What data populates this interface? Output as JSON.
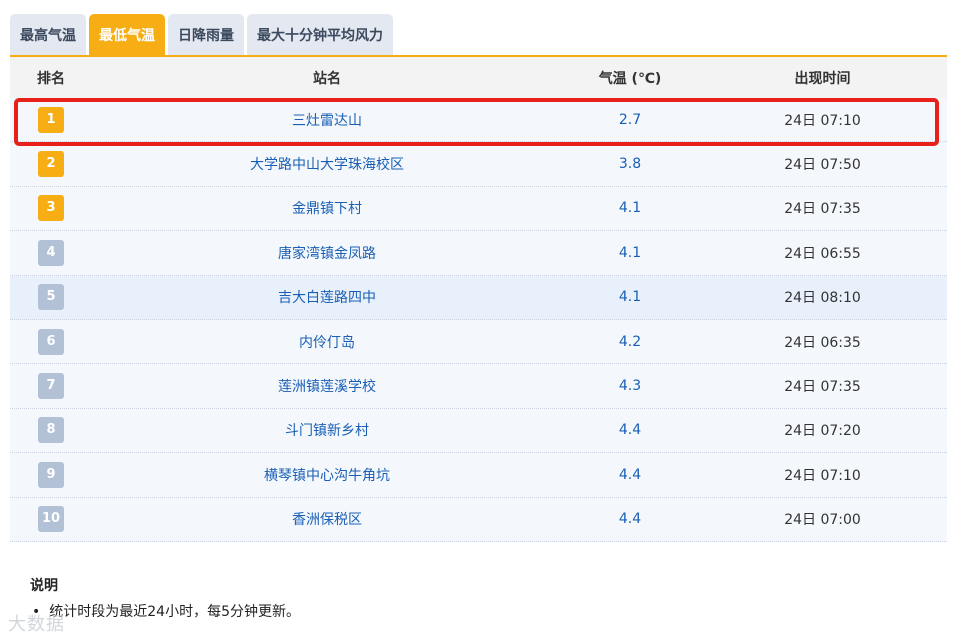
{
  "tabs": [
    {
      "label": "最高气温",
      "active": false
    },
    {
      "label": "最低气温",
      "active": true
    },
    {
      "label": "日降雨量",
      "active": false
    },
    {
      "label": "最大十分钟平均风力",
      "active": false
    }
  ],
  "table": {
    "headers": {
      "rank": "排名",
      "station": "站名",
      "temp": "气温 (℃)",
      "time": "出现时间"
    },
    "rows": [
      {
        "rank": "1",
        "station": "三灶雷达山",
        "temp": "2.7",
        "time": "24日 07:10"
      },
      {
        "rank": "2",
        "station": "大学路中山大学珠海校区",
        "temp": "3.8",
        "time": "24日 07:50"
      },
      {
        "rank": "3",
        "station": "金鼎镇下村",
        "temp": "4.1",
        "time": "24日 07:35"
      },
      {
        "rank": "4",
        "station": "唐家湾镇金凤路",
        "temp": "4.1",
        "time": "24日 06:55"
      },
      {
        "rank": "5",
        "station": "吉大白莲路四中",
        "temp": "4.1",
        "time": "24日 08:10"
      },
      {
        "rank": "6",
        "station": "内伶仃岛",
        "temp": "4.2",
        "time": "24日 06:35"
      },
      {
        "rank": "7",
        "station": "莲洲镇莲溪学校",
        "temp": "4.3",
        "time": "24日 07:35"
      },
      {
        "rank": "8",
        "station": "斗门镇新乡村",
        "temp": "4.4",
        "time": "24日 07:20"
      },
      {
        "rank": "9",
        "station": "横琴镇中心沟牛角坑",
        "temp": "4.4",
        "time": "24日 07:10"
      },
      {
        "rank": "10",
        "station": "香洲保税区",
        "temp": "4.4",
        "time": "24日 07:00"
      }
    ]
  },
  "notes": {
    "title": "说明",
    "items": [
      "统计时段为最近24小时，每5分钟更新。"
    ]
  },
  "watermark": "大数据",
  "colors": {
    "accent": "#f6ae14",
    "badge_gray": "#b3c1d6",
    "link": "#1a5fb4",
    "highlight_box": "#e8201a"
  }
}
